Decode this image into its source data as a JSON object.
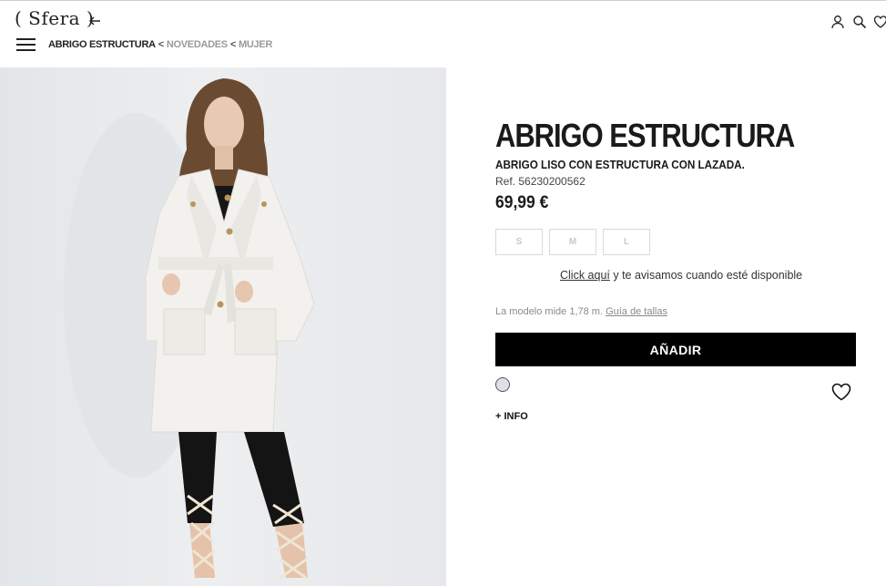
{
  "header": {
    "logo": "( Sfera )",
    "back_icon": "arrow-left-icon",
    "menu_icon": "hamburger-icon",
    "icons": [
      "user-icon",
      "search-icon",
      "heart-icon"
    ]
  },
  "breadcrumb": {
    "current": "ABRIGO ESTRUCTURA",
    "sep": "<",
    "links": [
      "NOVEDADES",
      "MUJER"
    ]
  },
  "product": {
    "title": "ABRIGO ESTRUCTURA",
    "subtitle": "ABRIGO LISO CON ESTRUCTURA CON LAZADA.",
    "ref": "Ref. 56230200562",
    "price": "69,99 €",
    "sizes": [
      "S",
      "M",
      "L"
    ],
    "notify_link": "Click aquí",
    "notify_rest": " y te avisamos cuando esté disponible",
    "model_text": "La modelo mide 1,78 m.",
    "size_guide": "Guía de tallas",
    "add_button": "AÑADIR",
    "color_swatch": "#dde0e6",
    "info_label": "+ INFO"
  }
}
